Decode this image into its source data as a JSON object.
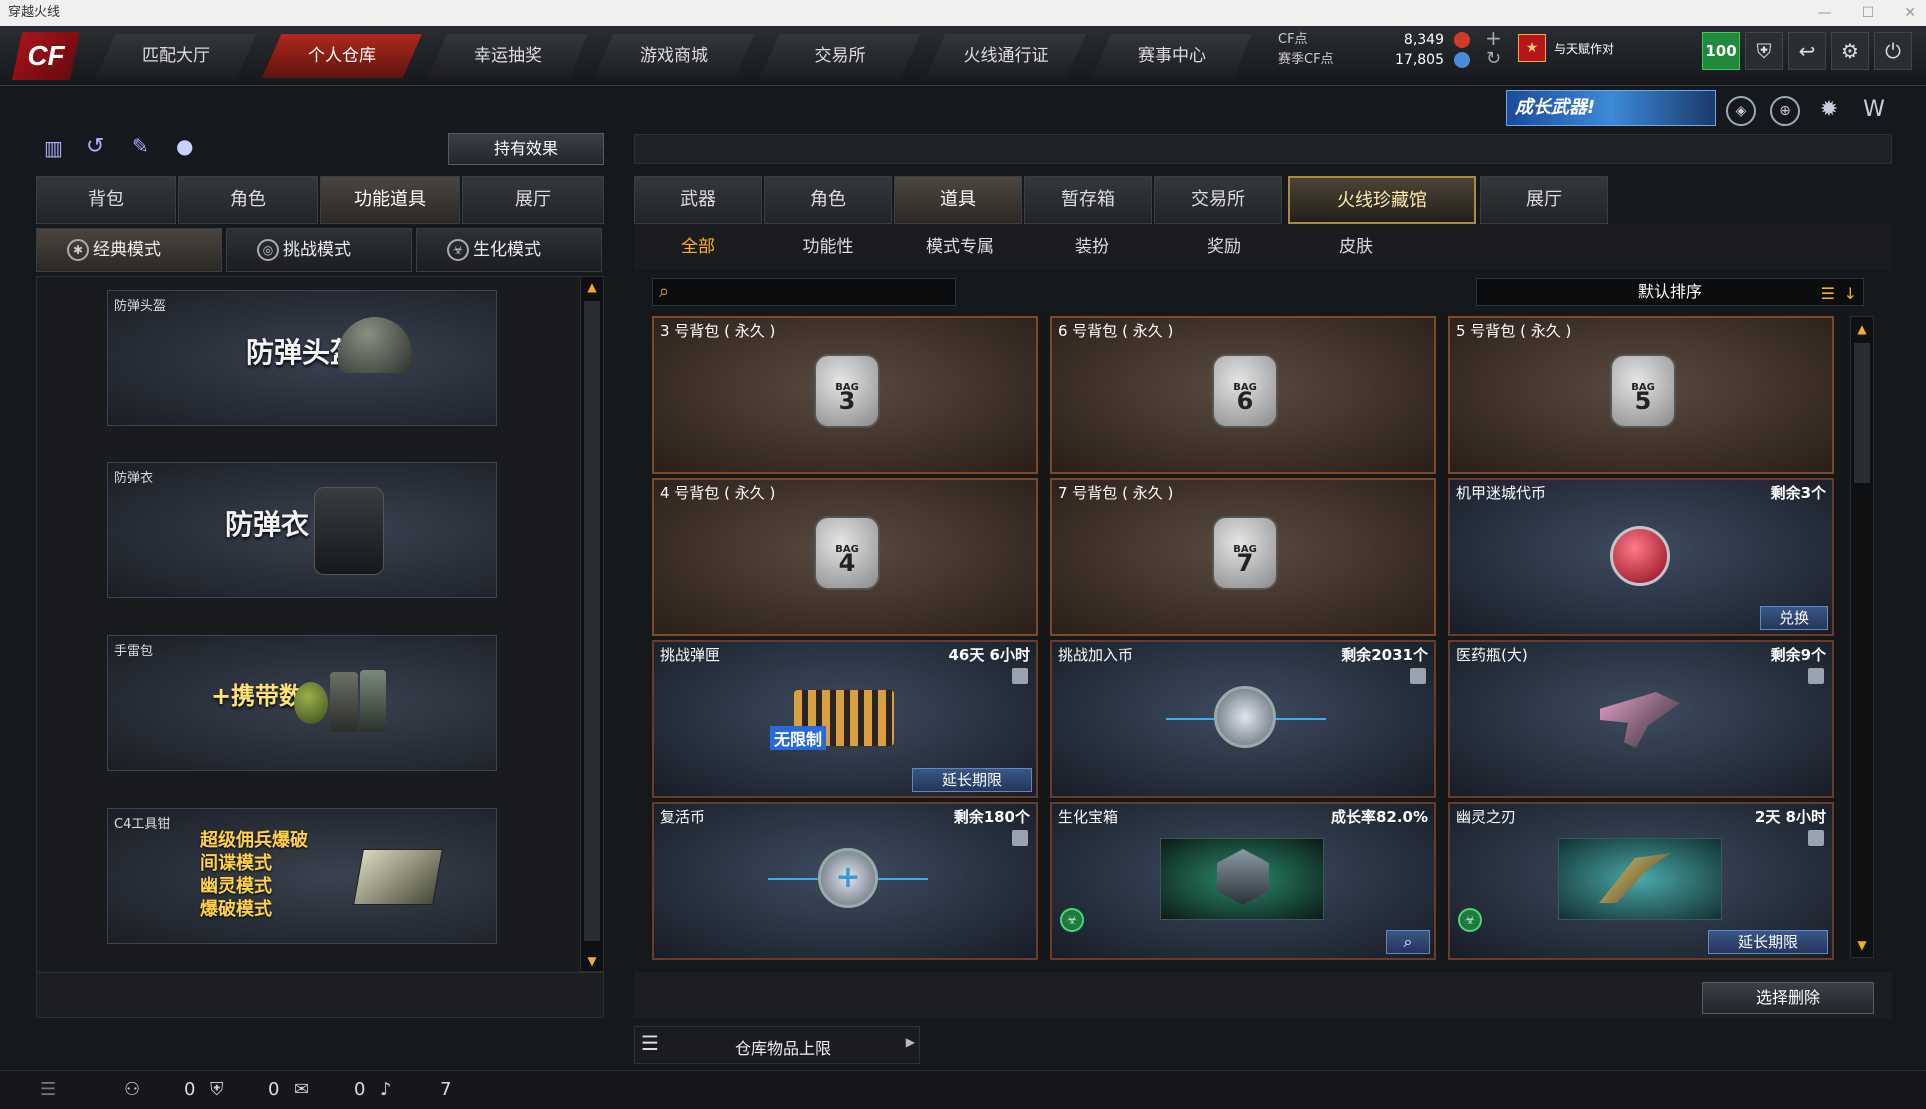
{
  "window": {
    "title": "穿越火线"
  },
  "nav": {
    "logo": "CF",
    "tabs": [
      "匹配大厅",
      "个人仓库",
      "幸运抽奖",
      "游戏商城",
      "交易所",
      "火线通行证",
      "赛事中心"
    ]
  },
  "currency": {
    "cf_label": "CF点",
    "cf_value": "8,349",
    "season_label": "赛季CF点",
    "season_value": "17,805"
  },
  "user": {
    "slogan": "与天赋作对",
    "badge": "100"
  },
  "banner": {
    "text": "成长武器!"
  },
  "left": {
    "effect_button": "持有效果",
    "tabs": [
      "背包",
      "角色",
      "功能道具",
      "展厅"
    ],
    "modes": [
      "经典模式",
      "挑战模式",
      "生化模式"
    ],
    "cards": [
      {
        "caption": "防弹头盔",
        "big": "防弹头盔"
      },
      {
        "caption": "防弹衣",
        "big": "防弹衣"
      },
      {
        "caption": "手雷包",
        "big": "+携带数"
      },
      {
        "caption": "C4工具钳",
        "lines": [
          "超级佣兵爆破",
          "间谍模式",
          "幽灵模式",
          "爆破模式"
        ]
      }
    ]
  },
  "right": {
    "tabs": [
      "武器",
      "角色",
      "道具",
      "暂存箱",
      "交易所",
      "火线珍藏馆",
      "展厅"
    ],
    "subtabs": [
      "全部",
      "功能性",
      "模式专属",
      "装扮",
      "奖励",
      "皮肤"
    ],
    "sort_label": "默认排序",
    "items": [
      {
        "name": "3 号背包 ( 永久 )",
        "bag": "3"
      },
      {
        "name": "6 号背包 ( 永久 )",
        "bag": "6"
      },
      {
        "name": "5 号背包 ( 永久 )",
        "bag": "5"
      },
      {
        "name": "4 号背包 ( 永久 )",
        "bag": "4"
      },
      {
        "name": "7 号背包 ( 永久 )",
        "bag": "7"
      },
      {
        "name": "机甲迷城代币",
        "info": "剩余3个",
        "button": "兑换"
      },
      {
        "name": "挑战弹匣",
        "info": "46天 6小时",
        "button": "延长期限",
        "art": "无限制"
      },
      {
        "name": "挑战加入币",
        "info": "剩余2031个"
      },
      {
        "name": "医药瓶(大)",
        "info": "剩余9个"
      },
      {
        "name": "复活币",
        "info": "剩余180个"
      },
      {
        "name": "生化宝箱",
        "info": "成长率82.0%"
      },
      {
        "name": "幽灵之刃",
        "info": "2天 8小时",
        "button": "延长期限"
      }
    ],
    "bag_text": "BAG",
    "delete_button": "选择删除",
    "capacity_label": "仓库物品上限"
  },
  "status": {
    "counts": [
      "0",
      "0",
      "0",
      "7"
    ]
  }
}
